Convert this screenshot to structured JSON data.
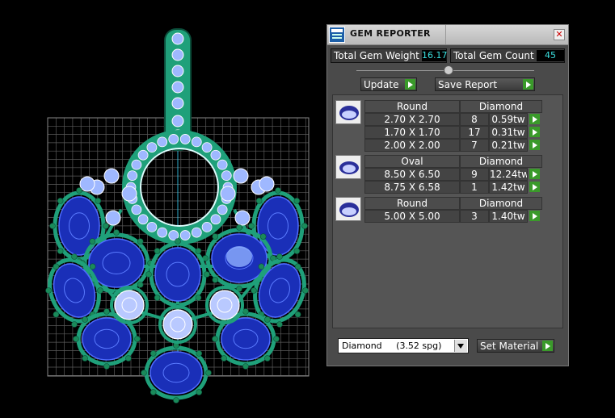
{
  "panel": {
    "title": "GEM REPORTER",
    "close_glyph": "✕",
    "total_weight_label": "Total Gem Weight",
    "total_weight_value": "16.17",
    "total_count_label": "Total Gem Count",
    "total_count_value": "45",
    "update_label": "Update",
    "save_report_label": "Save Report",
    "material_value": "Diamond     (3.52 spg)",
    "set_material_label": "Set Material"
  },
  "groups": [
    {
      "shape": "Round",
      "material": "Diamond",
      "rows": [
        {
          "size": "2.70 X 2.70",
          "count": "8",
          "weight": "0.59tw"
        },
        {
          "size": "1.70 X 1.70",
          "count": "17",
          "weight": "0.31tw"
        },
        {
          "size": "2.00 X 2.00",
          "count": "7",
          "weight": "0.21tw"
        }
      ]
    },
    {
      "shape": "Oval",
      "material": "Diamond",
      "rows": [
        {
          "size": "8.50 X 6.50",
          "count": "9",
          "weight": "12.24tw"
        },
        {
          "size": "8.75 X 6.58",
          "count": "1",
          "weight": "1.42tw"
        }
      ]
    },
    {
      "shape": "Round",
      "material": "Diamond",
      "rows": [
        {
          "size": "5.00 X 5.00",
          "count": "3",
          "weight": "1.40tw"
        }
      ]
    }
  ],
  "colors": {
    "accent_green": "#3a9a2a",
    "value_cyan": "#3ae0e0",
    "metal_green": "#1fa07a",
    "sapphire": "#1a2fb8",
    "diamond": "#9fb8ff"
  },
  "icons": [
    "gem-reporter-app-icon",
    "close-icon",
    "arrow-right-icon",
    "gem-thumbnail-icon",
    "dropdown-arrow-icon"
  ]
}
